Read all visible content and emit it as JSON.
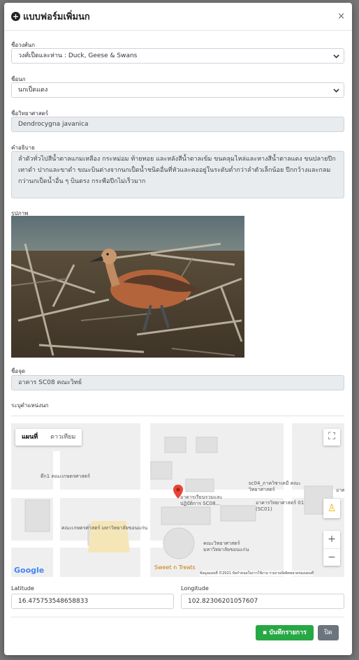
{
  "modal": {
    "title": "แบบฟอร์มเพิ่มนก",
    "close_symbol": "×"
  },
  "fields": {
    "family_label": "ชื่อวงศ์นก",
    "family_value": "วงศ์เป็ดและห่าน : Duck, Geese & Swans",
    "bird_label": "ชื่อนก",
    "bird_value": "นกเป็ดแดง",
    "scientific_label": "ชื่อวิทยาศาสตร์",
    "scientific_value": "Dendrocygna javanica",
    "description_label": "คำอธิบาย",
    "description_value": "ลำตัวทั่วไปสีน้ำตาลแกมเหลือง กระหม่อม ท้ายทอย และหลังสีน้ำตาลเข้ม ขนคลุมไหล่และหางสีน้ำตาลแดง ขนปลายปีกเทาดำ ปากและขาดำ ขณะบินต่างจากนกเป็ดน้ำชนิดอื่นที่หัวและคออยู่ในระดับต่ำกว่าลำตัวเล็กน้อย ปีกกว้างและกลมกว่านกเป็ดน้ำอื่น ๆ บินตรง กระพือปีกไม่เร็วมาก",
    "image_label": "รูปภาพ",
    "place_label": "ชื่อจุด",
    "place_value": "อาคาร SC08 คณะวิทย์",
    "location_label": "ระบุตำแหน่งนก",
    "latitude_label": "Latitude",
    "latitude_value": "16.475753548658833",
    "longitude_label": "Longitude",
    "longitude_value": "102.82306201057607"
  },
  "map": {
    "tab_map": "แผนที่",
    "tab_satellite": "ดาวเทียม",
    "zoom_in": "+",
    "zoom_out": "−",
    "google_logo": "Google",
    "poi": [
      "ตึก1 คณะเกษตรศาสตร์",
      "คณะเกษตรศาสตร์ มหาวิทยาลัยขอนแก่น",
      "อาคารเรียนรวมและปฏิบัติการ SC08...",
      "sc04_ภาควิชาเคมี คณะวิทยาศาสตร์",
      "อาคารวิทยาศาสตร์ 01 (SC01)",
      "คณะวิทยาศาสตร์ มหาวิทยาลัยขอนแก่น",
      "Sweet n Treats",
      "อาค"
    ],
    "attribution": "ข้อมูลแผนที่ ©2021   ข้อกำหนดในการใช้งาน   รายงานข้อผิดพลาดของแผนที่"
  },
  "buttons": {
    "save": "บันทึกรายการ",
    "close": "ปิด"
  },
  "colors": {
    "save_green": "#28a745",
    "close_gray": "#6c757d",
    "pin_red": "#ea4335"
  }
}
